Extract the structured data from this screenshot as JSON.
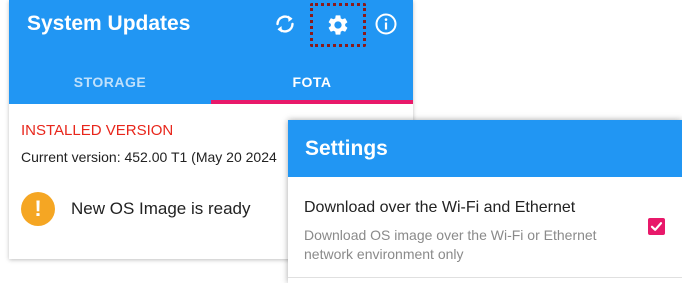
{
  "app": {
    "title": "System Updates",
    "icons": {
      "refresh": "refresh-icon",
      "settings": "gear-icon",
      "info": "info-icon"
    },
    "tabs": [
      {
        "label": "STORAGE",
        "selected": false
      },
      {
        "label": "FOTA",
        "selected": true
      }
    ],
    "installed_heading": "INSTALLED VERSION",
    "current_version": "Current version: 452.00 T1 (May 20 2024",
    "status": {
      "icon": "alert-icon",
      "text": "New OS Image is ready"
    }
  },
  "settings_dialog": {
    "title": "Settings",
    "preference": {
      "title": "Download over the Wi-Fi and Ethernet",
      "summary": "Download OS image over the Wi-Fi or Ethernet network environment only",
      "checked": true
    }
  },
  "colors": {
    "primary": "#2196f3",
    "accent": "#e8196a",
    "heading_red": "#e8261b",
    "warning": "#f5a623"
  }
}
